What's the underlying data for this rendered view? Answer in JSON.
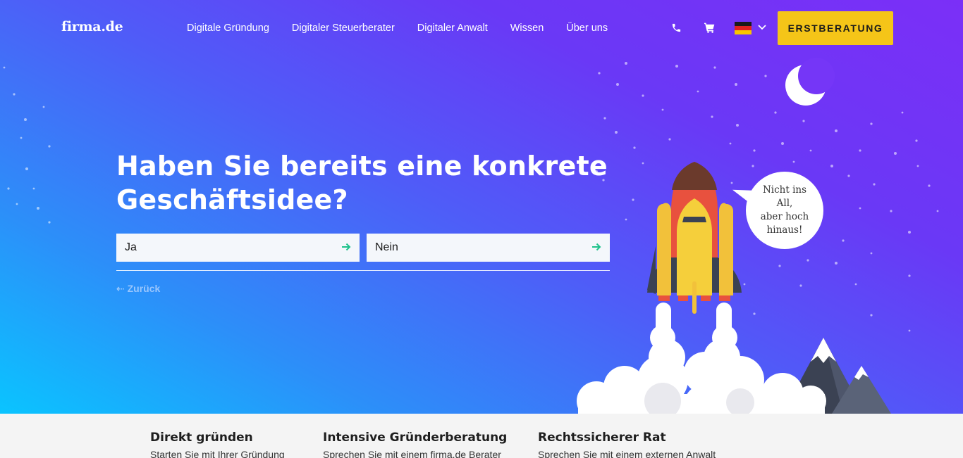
{
  "brand": {
    "logo": "firma.de"
  },
  "nav": {
    "items": [
      "Digitale Gründung",
      "Digitaler Steuerberater",
      "Digitaler Anwalt",
      "Wissen",
      "Über uns"
    ],
    "cta_label": "ERSTBERATUNG",
    "icons": [
      "phone-icon",
      "cart-icon",
      "german-flag-icon",
      "chevron-down-icon"
    ]
  },
  "hero": {
    "headline_line1": "Haben Sie bereits eine konkrete",
    "headline_line2": "Geschäftsidee?",
    "answers": [
      "Ja",
      "Nein"
    ],
    "back_label": "Zurück",
    "bubble_line1": "Nicht ins All,",
    "bubble_line2": "aber hoch",
    "bubble_line3": "hinaus!"
  },
  "colors": {
    "accent_yellow": "#f5c518",
    "arrow_green": "#1ec28b",
    "gradient_top_right": "#7b2ff7",
    "gradient_bottom_left": "#0ac4ff"
  },
  "footer": {
    "columns": [
      {
        "title": "Direkt gründen",
        "subtitle": "Starten Sie mit Ihrer Gründung"
      },
      {
        "title": "Intensive Gründerberatung",
        "subtitle": "Sprechen Sie mit einem firma.de Berater"
      },
      {
        "title": "Rechtssicherer Rat",
        "subtitle": "Sprechen Sie mit einem externen Anwalt"
      }
    ]
  }
}
